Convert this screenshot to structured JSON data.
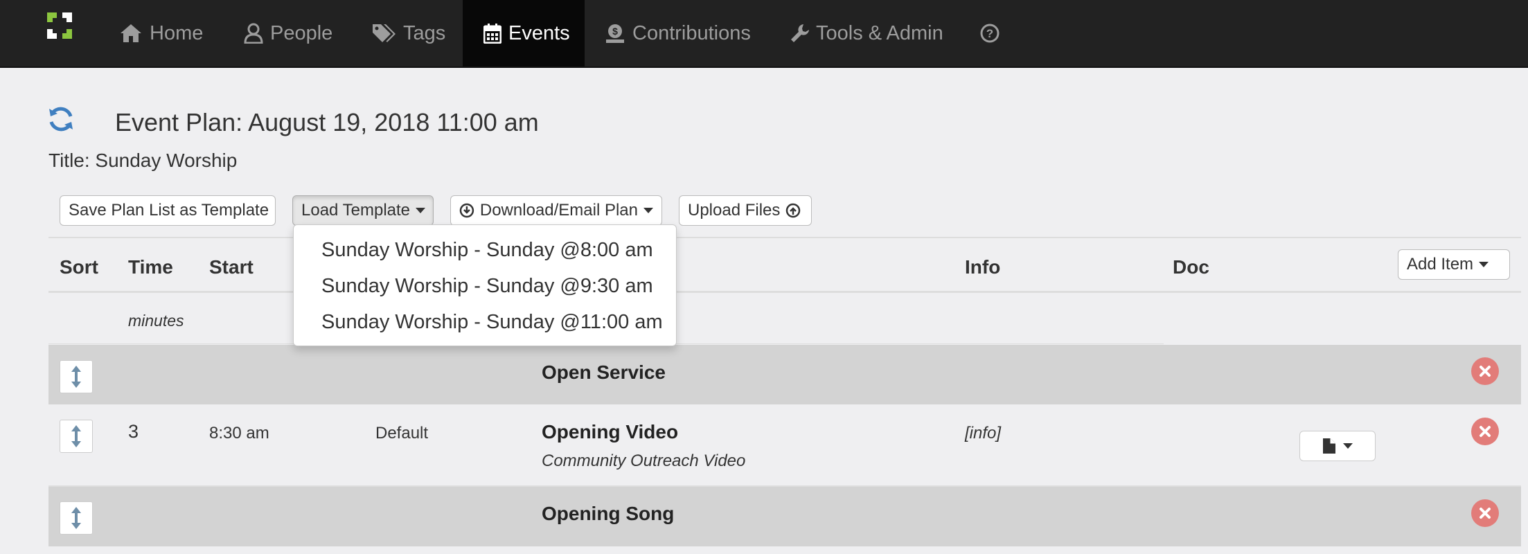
{
  "nav": {
    "items": [
      {
        "label": "Home",
        "icon": "home-icon"
      },
      {
        "label": "People",
        "icon": "user-icon"
      },
      {
        "label": "Tags",
        "icon": "tags-icon"
      },
      {
        "label": "Events",
        "icon": "calendar-icon",
        "active": true
      },
      {
        "label": "Contributions",
        "icon": "money-bag-icon"
      },
      {
        "label": "Tools & Admin",
        "icon": "wrench-icon"
      }
    ],
    "help_icon": "question-circle-icon"
  },
  "header": {
    "title": "Event Plan: August 19, 2018 11:00 am",
    "subtitle": "Title: Sunday Worship"
  },
  "toolbar": {
    "save_template": "Save Plan List as Template",
    "load_template": "Load Template",
    "download_email": "Download/Email Plan",
    "upload_files": "Upload Files"
  },
  "load_template_menu": {
    "options": [
      "Sunday Worship - Sunday @8:00 am",
      "Sunday Worship - Sunday @9:30 am",
      "Sunday Worship - Sunday @11:00 am"
    ]
  },
  "table": {
    "headers": {
      "sort": "Sort",
      "time": "Time",
      "start": "Start",
      "info": "Info",
      "doc": "Doc"
    },
    "add_item": "Add Item",
    "time_unit": "minutes",
    "rows": [
      {
        "type": "header",
        "title": "Open Service"
      },
      {
        "type": "item",
        "time": "3",
        "start": "8:30 am",
        "category": "Default",
        "title": "Opening Video",
        "description": "Community Outreach Video",
        "info": "[info]"
      },
      {
        "type": "header",
        "title": "Opening Song"
      }
    ]
  },
  "colors": {
    "navbar_bg": "#222222",
    "active_nav_bg": "#080808",
    "page_bg": "#efeff1",
    "section_row_bg": "#d3d3d3",
    "delete_red": "#e27c79",
    "logo_green": "#8cc63f",
    "refresh_blue": "#3f7fc0"
  }
}
